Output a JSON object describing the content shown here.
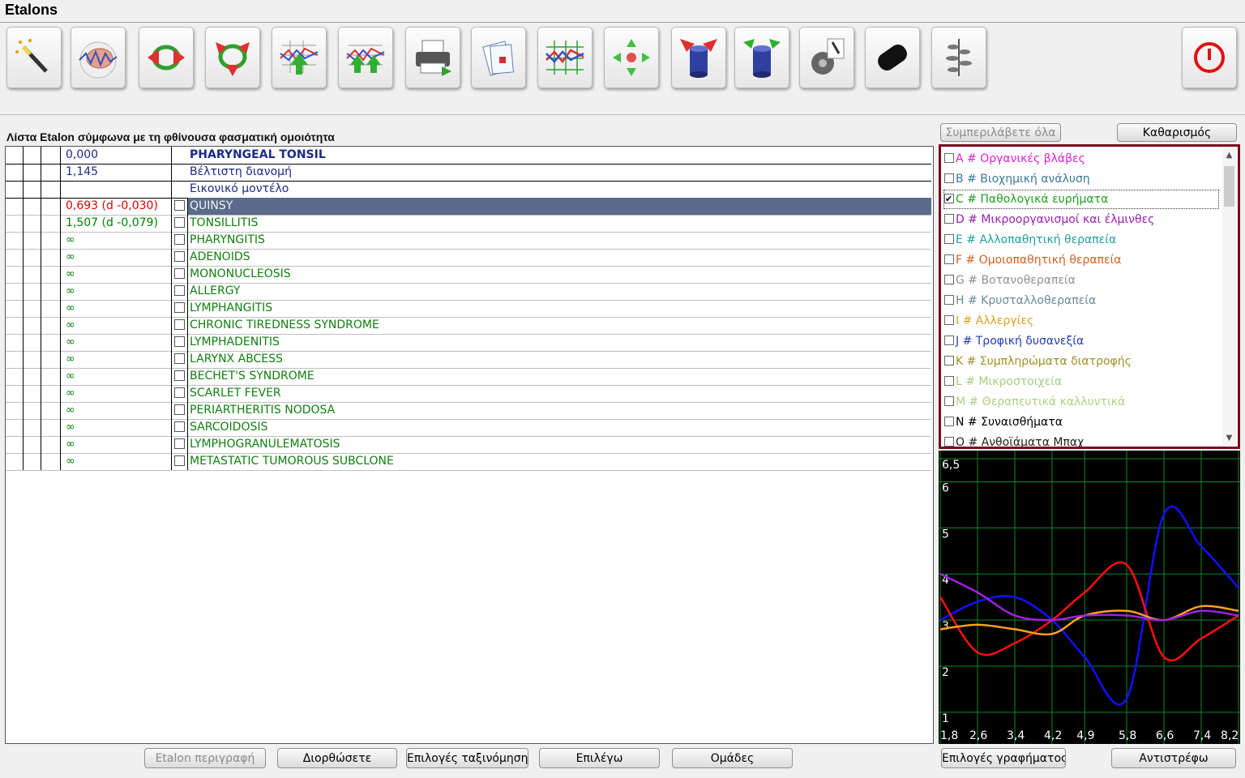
{
  "window": {
    "title": "Etalons"
  },
  "toolbar": {
    "buttons": [
      {
        "name": "magic-wand-icon"
      },
      {
        "name": "brain-icon"
      },
      {
        "name": "red-arrows-cycle-icon"
      },
      {
        "name": "red-arrows-down-icon"
      },
      {
        "name": "chart-up-arrow-icon"
      },
      {
        "name": "chart-double-arrow-icon"
      },
      {
        "name": "printer-icon"
      },
      {
        "name": "clipboard-icon"
      },
      {
        "name": "chart-grid-icon"
      },
      {
        "name": "cross-arrows-icon"
      },
      {
        "name": "cylinder-red-arrows-icon"
      },
      {
        "name": "cylinder-green-arrows-icon"
      },
      {
        "name": "microscope-gear-icon"
      },
      {
        "name": "black-stone-icon"
      },
      {
        "name": "plant-icon"
      }
    ],
    "power": {
      "name": "power-icon"
    }
  },
  "list": {
    "header": "Λίστα Etalon σύμφωνα με τη φθίνουσα φασματική ομοιότητα",
    "top_rows": [
      {
        "value": "0,000",
        "name": "PHARYNGEAL TONSIL"
      },
      {
        "value": "1,145",
        "name": "Βέλτιστη διανομή"
      },
      {
        "value": "",
        "name": "Εικονικό μοντέλο"
      }
    ],
    "rows": [
      {
        "value": "0,693 (d -0,030)",
        "name": "QUINSY",
        "value_color": "#e00000",
        "selected": true
      },
      {
        "value": "1,507 (d -0,079)",
        "name": "TONSILLITIS",
        "value_color": "#008000"
      },
      {
        "value": "∞",
        "name": "PHARYNGITIS"
      },
      {
        "value": "∞",
        "name": "ADENOIDS"
      },
      {
        "value": "∞",
        "name": "MONONUCLEOSIS"
      },
      {
        "value": "∞",
        "name": "ALLERGY"
      },
      {
        "value": "∞",
        "name": "LYMPHANGITIS"
      },
      {
        "value": "∞",
        "name": "CHRONIC TIREDNESS SYNDROME"
      },
      {
        "value": "∞",
        "name": "LYMPHADENITIS"
      },
      {
        "value": "∞",
        "name": "LARYNX  ABCESS"
      },
      {
        "value": "∞",
        "name": "BECHET'S  SYNDROME"
      },
      {
        "value": "∞",
        "name": "SCARLET FEVER"
      },
      {
        "value": "∞",
        "name": "PERIARTHERITIS  NODOSA"
      },
      {
        "value": "∞",
        "name": "SARCOIDOSIS"
      },
      {
        "value": "∞",
        "name": "LYMPHOGRANULEMATOSIS"
      },
      {
        "value": "∞",
        "name": "METASTATIC TUMOROUS SUBCLONE"
      }
    ]
  },
  "bottom_buttons": {
    "description": "Etalon περιγραφή",
    "correct": "Διορθώσετε",
    "sort_options": "Επιλογές ταξινόμησης",
    "select": "Επιλέγω",
    "groups": "Ομάδες",
    "graph_options": "Επιλογές γραφήματος",
    "invert": "Αντιστρέφω"
  },
  "right_panel": {
    "include_all": "Συμπεριλάβετε όλα",
    "clear": "Καθαρισμός",
    "categories": [
      {
        "label": "A # Οργανικές βλάβες",
        "color": "#e020d0",
        "checked": false
      },
      {
        "label": "B # Βιοχημική ανάλυση",
        "color": "#3a7a9a",
        "checked": false
      },
      {
        "label": "C # Παθολογικά ευρήματα",
        "color": "#20a020",
        "checked": true
      },
      {
        "label": "D # Μικροοργανισμοί και έλμινθες",
        "color": "#9a20b0",
        "checked": false
      },
      {
        "label": "E # Αλλοπαθητική θεραπεία",
        "color": "#20a0a0",
        "checked": false
      },
      {
        "label": "F # Ομοιοπαθητική θεραπεία",
        "color": "#d06020",
        "checked": false
      },
      {
        "label": "G # Βοτανοθεραπεία",
        "color": "#909090",
        "checked": false
      },
      {
        "label": "H # Κρυσταλλοθεραπεία",
        "color": "#6a8a9a",
        "checked": false
      },
      {
        "label": "I # Αλλεργίες",
        "color": "#e0a020",
        "checked": false
      },
      {
        "label": "J # Τροφική δυσανεξία",
        "color": "#2040b0",
        "checked": false
      },
      {
        "label": "K # Συμπληρώματα διατροφής",
        "color": "#a09020",
        "checked": false
      },
      {
        "label": "L # Μικροστοιχεία",
        "color": "#a0d080",
        "checked": false
      },
      {
        "label": "M # Θεραπευτικά καλλυντικά",
        "color": "#b0d080",
        "checked": false
      },
      {
        "label": "N # Συναισθήματα",
        "color": "#000000",
        "checked": false
      },
      {
        "label": "O # Ανθοϊάματα Μπαχ",
        "color": "#202020",
        "checked": false
      }
    ]
  },
  "chart_data": {
    "type": "line",
    "ylim": [
      0.7,
      6.5
    ],
    "xlim": [
      1.8,
      8.2
    ],
    "y_ticks": [
      "6,5",
      "6",
      "5",
      "4",
      "3",
      "2",
      "1"
    ],
    "x_ticks": [
      "1,8",
      "2,6",
      "3,4",
      "4,2",
      "4,9",
      "5,8",
      "6,6",
      "7,4",
      "8,2"
    ],
    "grid": true,
    "series": [
      {
        "color": "#1010ff",
        "x": [
          1.8,
          2.6,
          3.4,
          4.2,
          4.9,
          5.8,
          6.6,
          7.4,
          8.2
        ],
        "y": [
          3.0,
          3.4,
          3.5,
          3.0,
          2.2,
          1.3,
          5.3,
          4.6,
          3.7
        ]
      },
      {
        "color": "#ff1010",
        "x": [
          1.8,
          2.6,
          3.4,
          4.2,
          4.9,
          5.8,
          6.6,
          7.4,
          8.2
        ],
        "y": [
          3.5,
          2.3,
          2.5,
          3.0,
          3.6,
          4.2,
          2.2,
          2.6,
          3.1
        ]
      },
      {
        "color": "#ffa020",
        "x": [
          1.8,
          2.6,
          3.4,
          4.2,
          4.9,
          5.8,
          6.6,
          7.4,
          8.2
        ],
        "y": [
          2.8,
          2.9,
          2.8,
          2.7,
          3.1,
          3.2,
          3.0,
          3.3,
          3.2
        ]
      },
      {
        "color": "#a020e0",
        "x": [
          1.8,
          2.6,
          3.4,
          4.2,
          4.9,
          5.8,
          6.6,
          7.4,
          8.2
        ],
        "y": [
          4.0,
          3.6,
          3.1,
          3.0,
          3.1,
          3.1,
          3.0,
          3.2,
          3.1
        ]
      }
    ]
  }
}
